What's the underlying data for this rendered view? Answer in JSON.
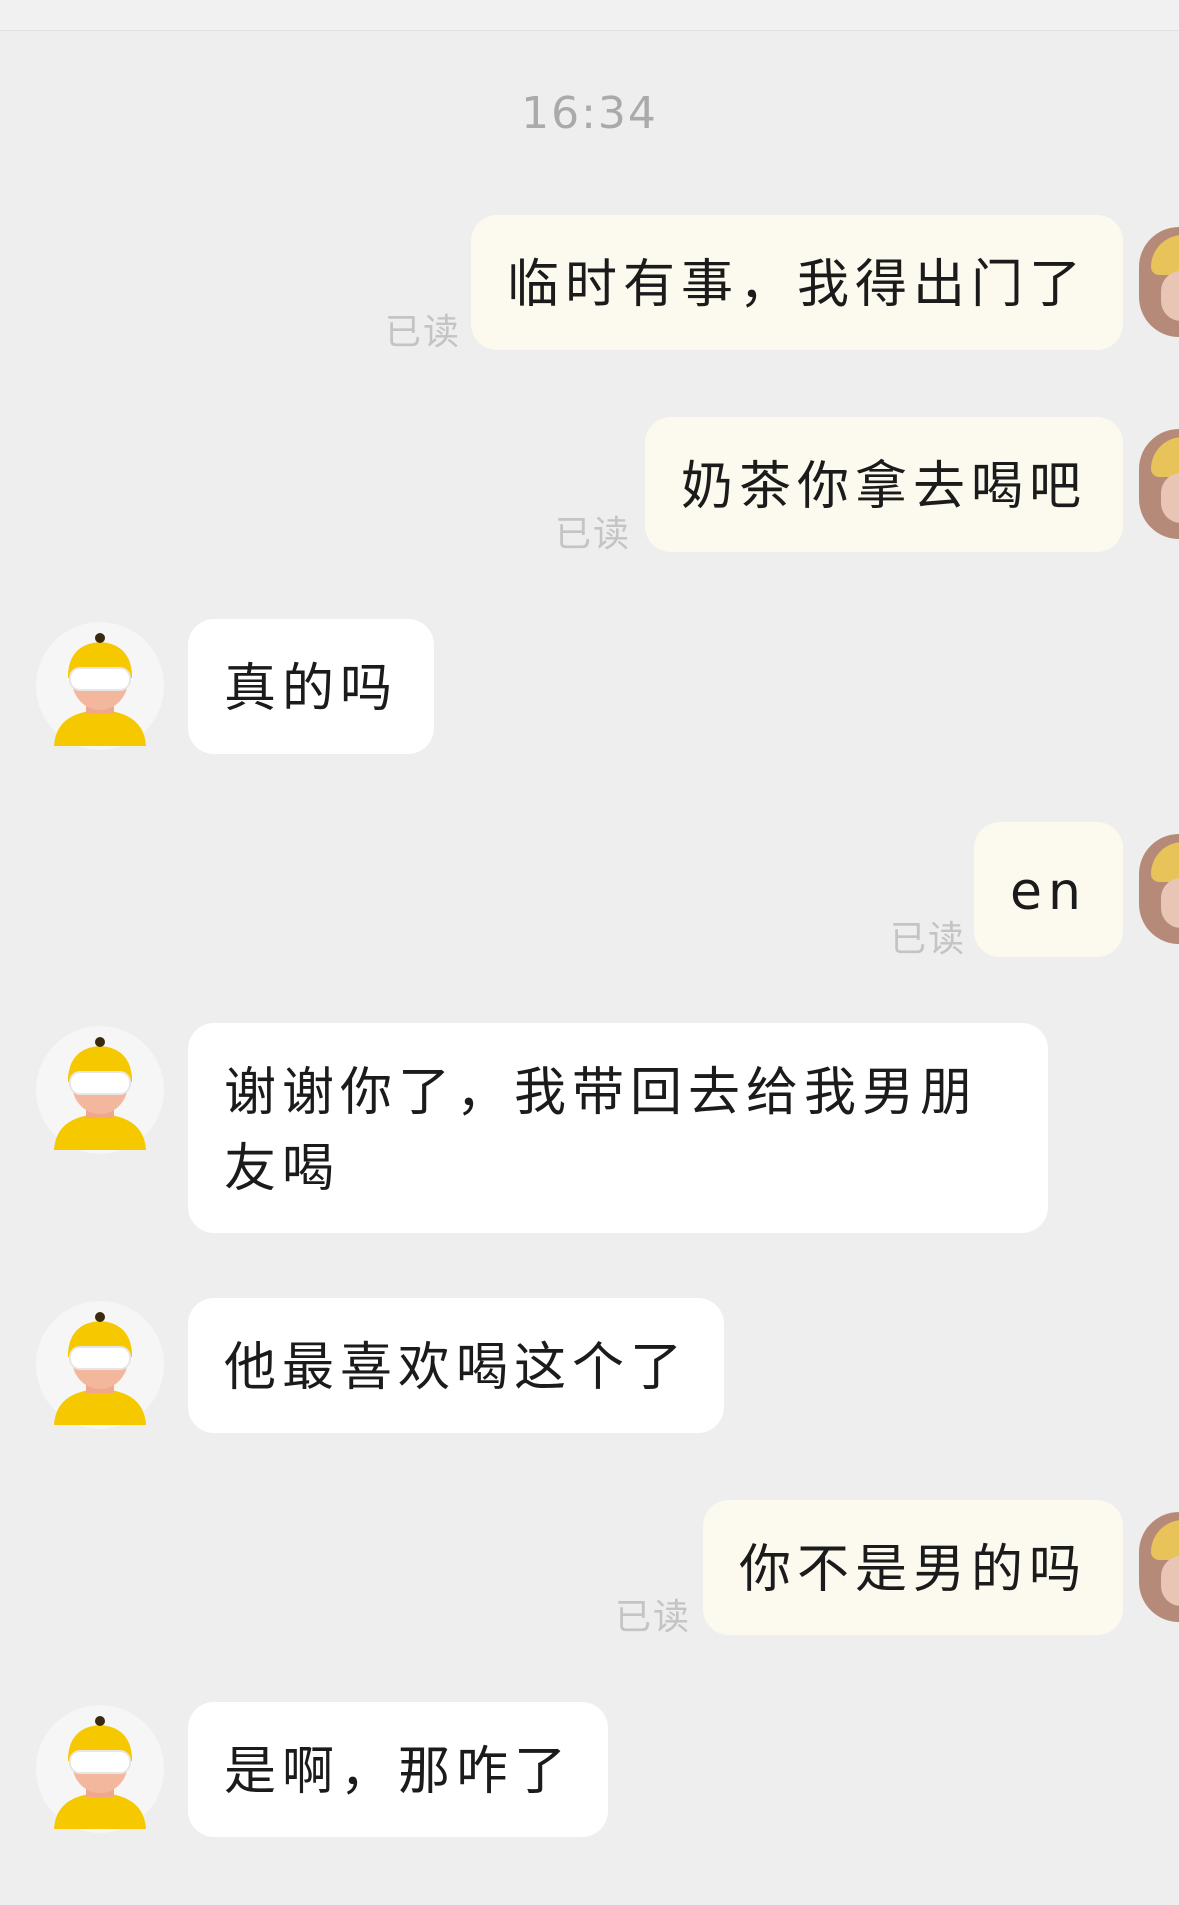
{
  "chat": {
    "timestamp": "16:34",
    "read_label": "已读",
    "messages": [
      {
        "side": "sent",
        "text": "临时有事，我得出门了",
        "read": "已读"
      },
      {
        "side": "sent",
        "text": "奶茶你拿去喝吧",
        "read": "已读"
      },
      {
        "side": "received",
        "text": "真的吗"
      },
      {
        "side": "sent",
        "text": "en",
        "read": "已读"
      },
      {
        "side": "received",
        "text": "谢谢你了，我带回去给我男朋友喝"
      },
      {
        "side": "received",
        "text": "他最喜欢喝这个了"
      },
      {
        "side": "sent",
        "text": "你不是男的吗",
        "read": "已读"
      },
      {
        "side": "received",
        "text": "是啊，那咋了"
      }
    ]
  },
  "colors": {
    "background": "#eeeeee",
    "sent_bubble": "#fcf9ee",
    "received_bubble": "#ffffff",
    "read_text": "#c4c4c4",
    "avatar_yellow": "#f5c800"
  },
  "icons": {
    "received_avatar": "cartoon-person-yellow-helmet-avatar",
    "sent_avatar": "user-avatar"
  }
}
